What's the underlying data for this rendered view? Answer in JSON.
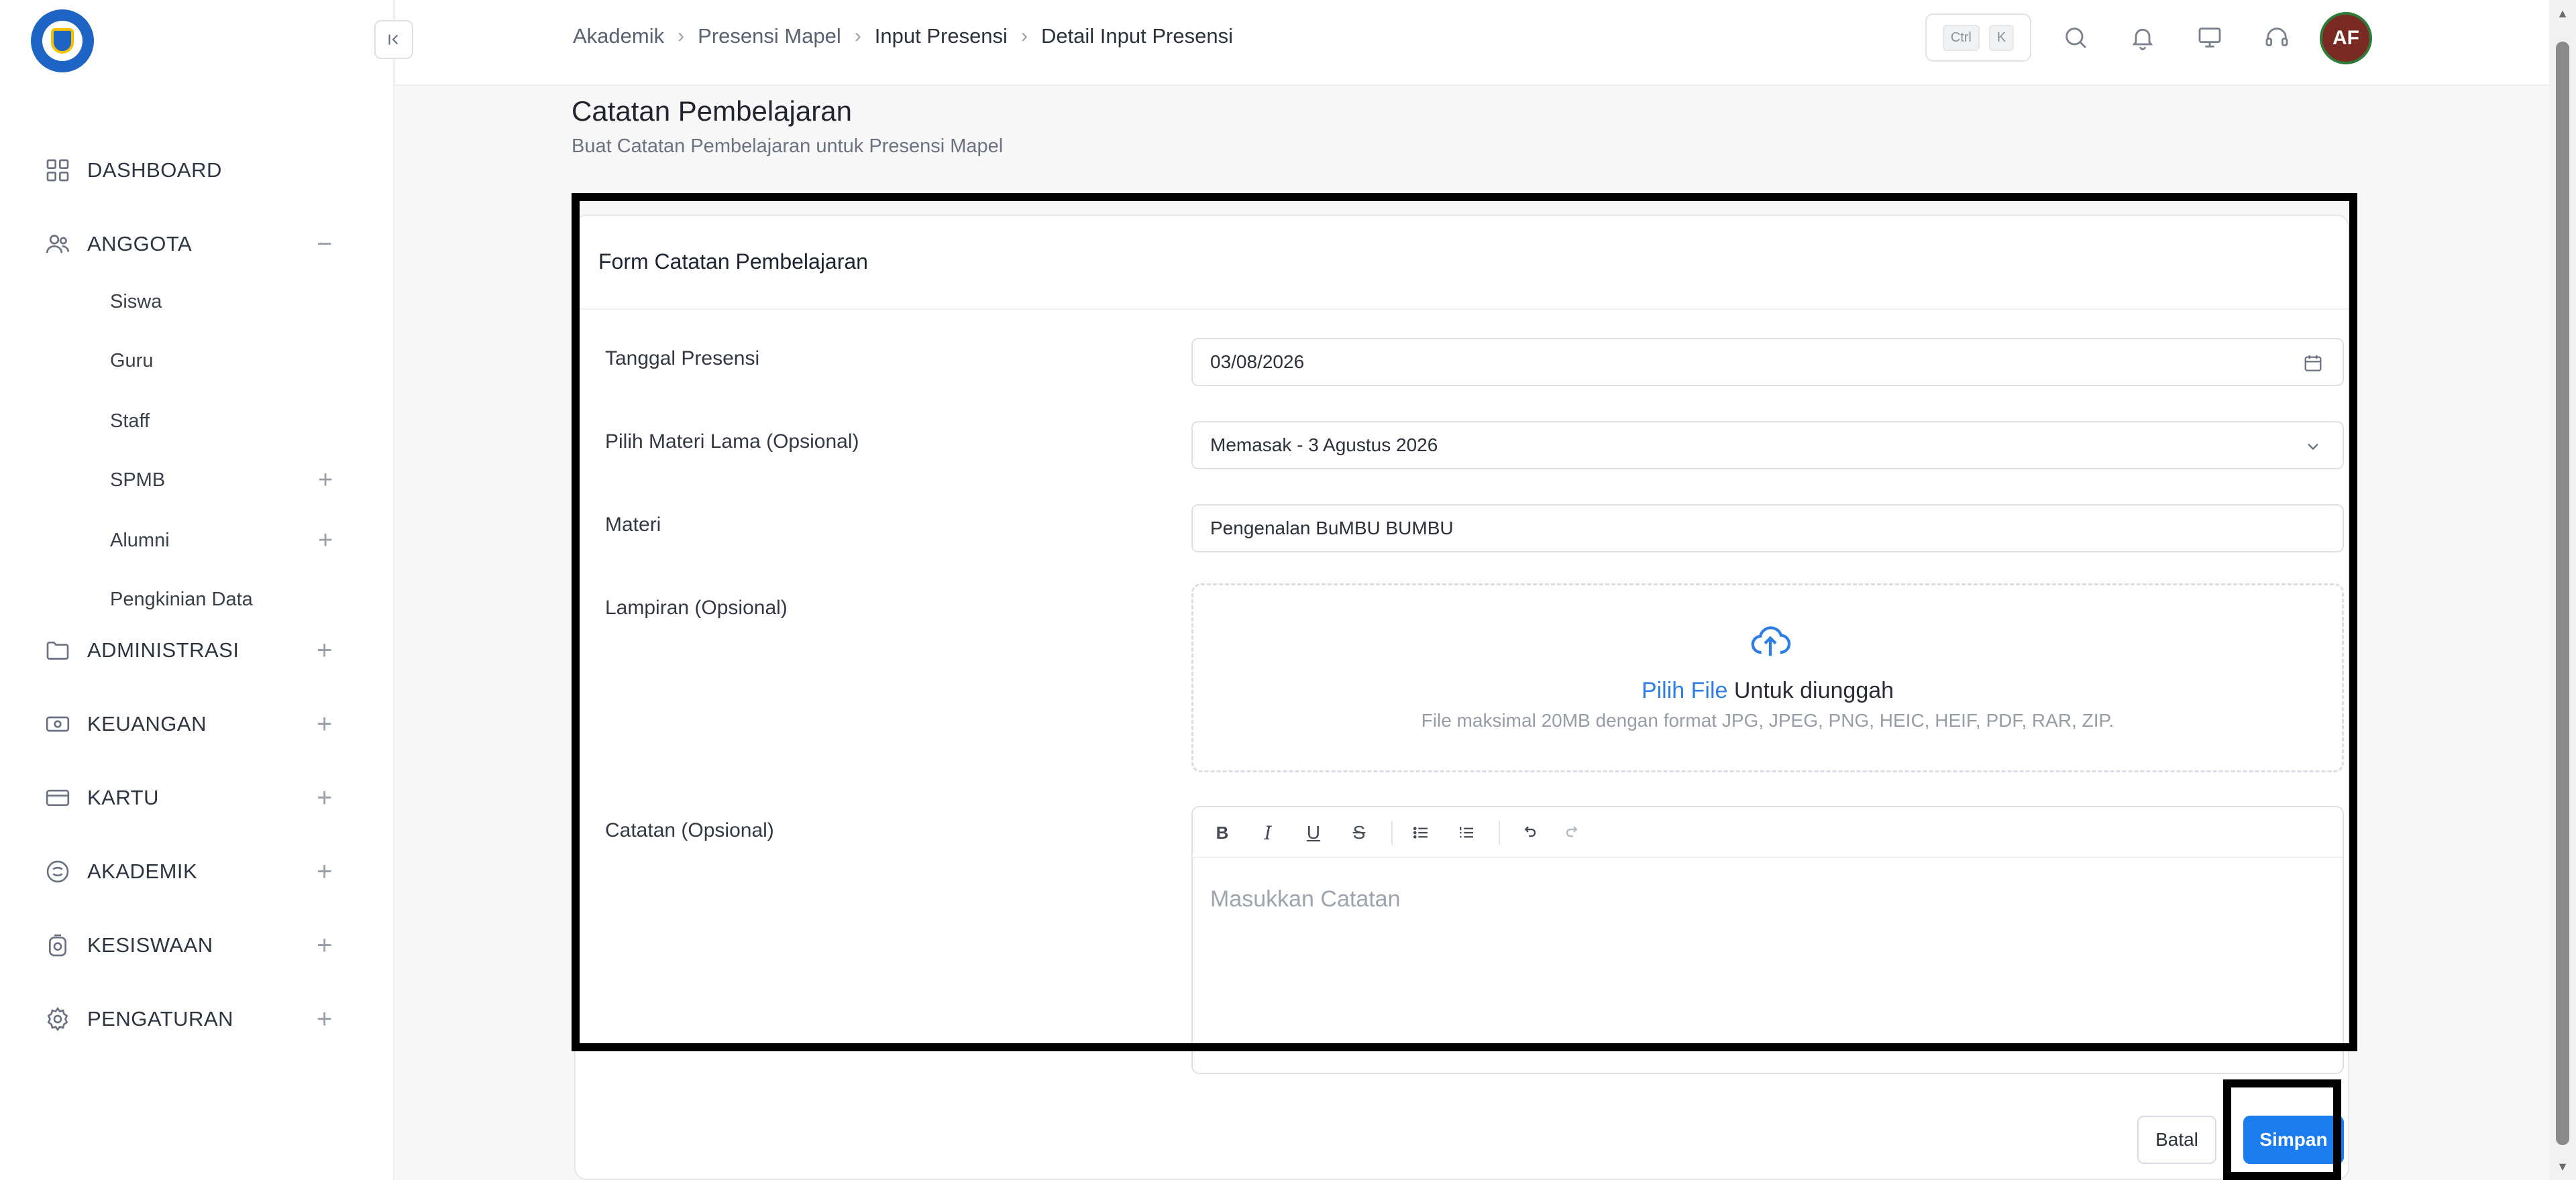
{
  "sidebar": {
    "items": [
      {
        "label": "DASHBOARD",
        "icon": "dashboard-grid-icon"
      },
      {
        "label": "ANGGOTA",
        "icon": "users-icon",
        "expander": "−"
      },
      {
        "label": "ADMINISTRASI",
        "icon": "folder-icon",
        "expander": "+"
      },
      {
        "label": "KEUANGAN",
        "icon": "money-icon",
        "expander": "+"
      },
      {
        "label": "KARTU",
        "icon": "card-icon",
        "expander": "+"
      },
      {
        "label": "AKADEMIK",
        "icon": "academic-icon",
        "expander": "+"
      },
      {
        "label": "KESISWAAN",
        "icon": "student-icon",
        "expander": "+"
      },
      {
        "label": "PENGATURAN",
        "icon": "gear-icon",
        "expander": "+"
      }
    ],
    "anggota_children": [
      {
        "label": "Siswa"
      },
      {
        "label": "Guru"
      },
      {
        "label": "Staff"
      },
      {
        "label": "SPMB",
        "expander": "+"
      },
      {
        "label": "Alumni",
        "expander": "+"
      },
      {
        "label": "Pengkinian Data"
      }
    ]
  },
  "header": {
    "breadcrumb": [
      "Akademik",
      "Presensi Mapel",
      "Input Presensi",
      "Detail Input Presensi"
    ],
    "shortcut": {
      "key1": "Ctrl",
      "key2": "K"
    },
    "avatar_initials": "AF"
  },
  "page": {
    "title": "Catatan Pembelajaran",
    "subtitle": "Buat Catatan Pembelajaran untuk Presensi Mapel"
  },
  "form": {
    "title": "Form Catatan Pembelajaran",
    "tanggal_label": "Tanggal Presensi",
    "tanggal_value": "03/08/2026",
    "materi_lama_label": "Pilih Materi Lama (Opsional)",
    "materi_lama_value": "Memasak - 3 Agustus 2026",
    "materi_label": "Materi",
    "materi_value": "Pengenalan BuMBU BUMBU",
    "lampiran_label": "Lampiran (Opsional)",
    "upload_link": "Pilih File",
    "upload_text": " Untuk diunggah",
    "upload_hint": "File maksimal 20MB dengan format JPG, JPEG, PNG, HEIC, HEIF, PDF, RAR, ZIP.",
    "catatan_label": "Catatan (Opsional)",
    "catatan_placeholder": "Masukkan Catatan",
    "toolbar": {
      "bold": "B",
      "italic": "I",
      "underline": "U",
      "strike": "S"
    },
    "batal_label": "Batal",
    "simpan_label": "Simpan"
  },
  "colors": {
    "accent": "#1b7cf0",
    "link": "#2e7ee6",
    "avatar_bg": "#7a2a22"
  }
}
